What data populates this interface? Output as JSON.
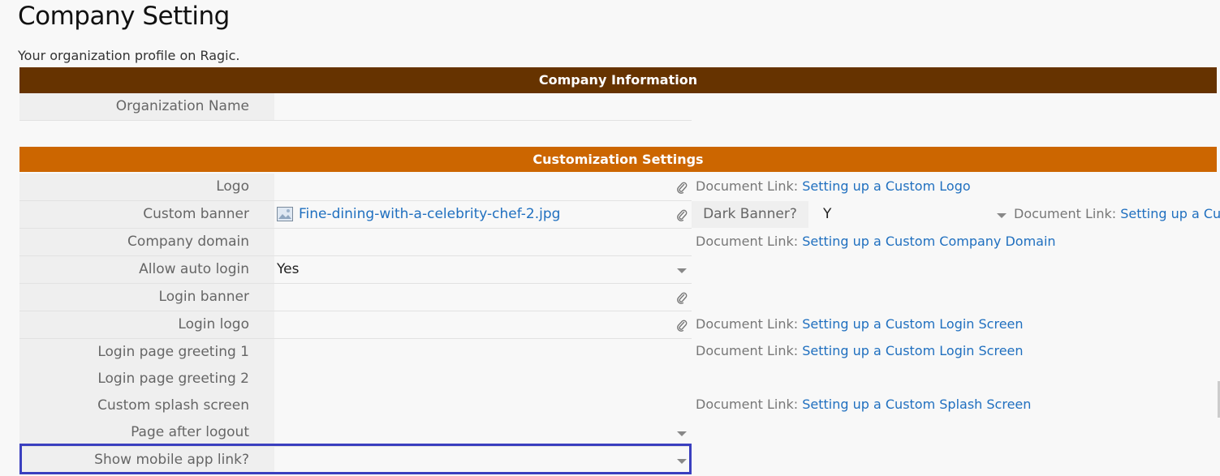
{
  "page": {
    "title": "Company Setting",
    "subtitle": "Your organization profile on Ragic."
  },
  "sections": {
    "company_information": "Company Information",
    "customization_settings": "Customization Settings"
  },
  "fields": {
    "organization_name": {
      "label": "Organization Name",
      "value": ""
    },
    "logo": {
      "label": "Logo",
      "value": "",
      "icon": "paperclip-icon"
    },
    "custom_banner": {
      "label": "Custom banner",
      "value": "Fine-dining-with-a-celebrity-chef-2.jpg",
      "icon": "paperclip-icon"
    },
    "dark_banner": {
      "label": "Dark Banner?",
      "value": "Y"
    },
    "company_domain": {
      "label": "Company domain",
      "value": ""
    },
    "allow_auto_login": {
      "label": "Allow auto login",
      "value": "Yes"
    },
    "login_banner": {
      "label": "Login banner",
      "value": "",
      "icon": "paperclip-icon"
    },
    "login_logo": {
      "label": "Login logo",
      "value": "",
      "icon": "paperclip-icon"
    },
    "login_greeting_1": {
      "label": "Login page greeting 1",
      "value": ""
    },
    "login_greeting_2": {
      "label": "Login page greeting 2",
      "value": ""
    },
    "custom_splash": {
      "label": "Custom splash screen",
      "value": ""
    },
    "page_after_logout": {
      "label": "Page after logout",
      "value": ""
    },
    "show_mobile_app_link": {
      "label": "Show mobile app link?",
      "value": ""
    }
  },
  "doc_links": {
    "prefix": "Document Link:",
    "logo": "Setting up a Custom Logo",
    "banner": "Setting up a Cust",
    "domain": "Setting up a Custom Company Domain",
    "login_logo": "Setting up a Custom Login Screen",
    "login_greeting": "Setting up a Custom Login Screen",
    "splash": "Setting up a Custom Splash Screen"
  },
  "colors": {
    "company_header": "#663300",
    "custom_header": "#cc6600",
    "link": "#1f6fbf",
    "highlight": "#3a3fbf"
  }
}
